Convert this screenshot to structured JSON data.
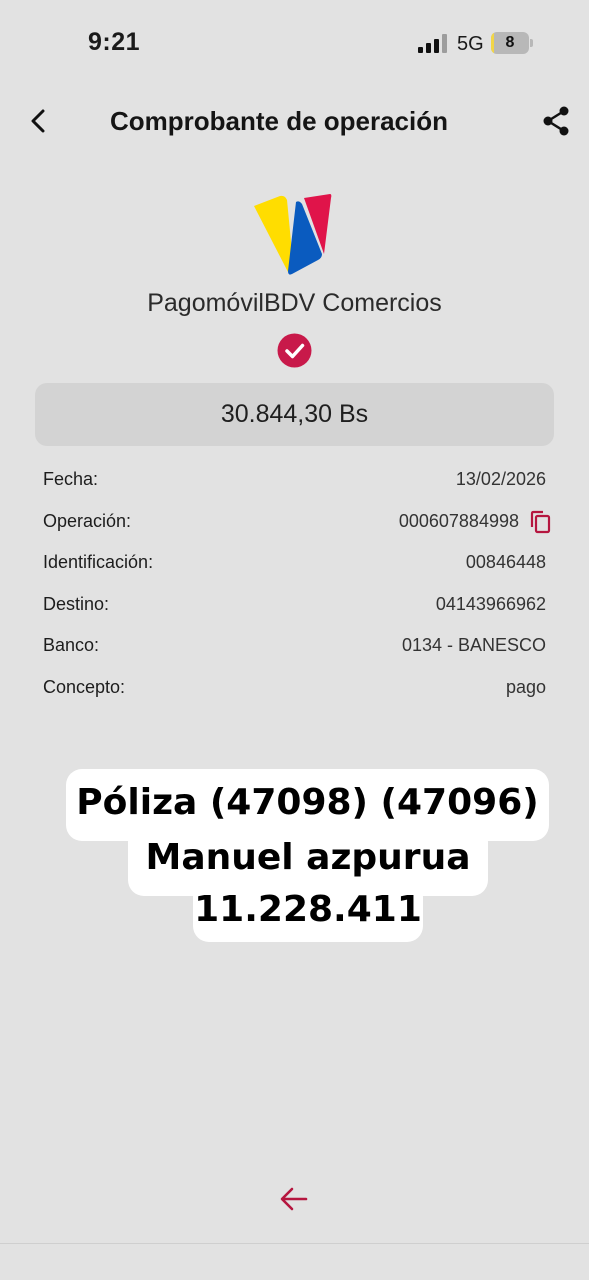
{
  "status_bar": {
    "time": "9:21",
    "network": "5G",
    "battery_level": "8",
    "battery_fraction": 0.08,
    "signal_bars_active": 3
  },
  "header": {
    "title": "Comprobante de operación",
    "back_icon": "chevron-left-icon",
    "share_icon": "share-icon"
  },
  "brand": {
    "name": "PagomóvilBDV Comercios",
    "logo_colors": [
      "#ffdd00",
      "#0a5bbf",
      "#e0144a"
    ],
    "check_color": "#c8194a"
  },
  "amount": "30.844,30 Bs",
  "details": [
    {
      "label": "Fecha:",
      "value": "13/02/2026"
    },
    {
      "label": "Operación:",
      "value": "000607884998"
    },
    {
      "label": "Identificación:",
      "value": "00846448"
    },
    {
      "label": "Destino:",
      "value": "04143966962"
    },
    {
      "label": "Banco:",
      "value": "0134 - BANESCO"
    },
    {
      "label": "Concepto:",
      "value": "pago"
    }
  ],
  "note": {
    "line1": "Póliza (47098) (47096)",
    "line2": "Manuel azpurua",
    "line3": "11.228.411"
  },
  "accent_color": "#b5163f"
}
